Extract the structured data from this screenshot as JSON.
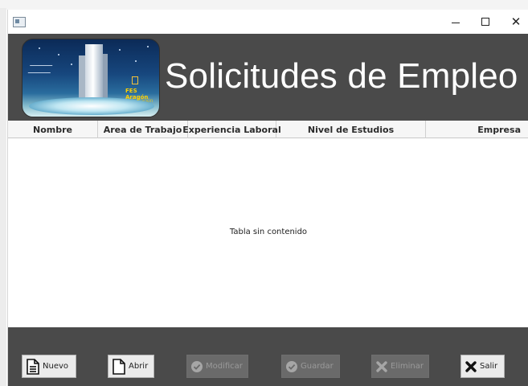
{
  "window": {
    "title": "",
    "minimize_glyph": "",
    "maximize_glyph": "",
    "close_glyph": "✕"
  },
  "header": {
    "title": "Solicitudes de Empleo",
    "logo_text_primary": "FES Aragón",
    "logo_text_secondary": "FES Aragón"
  },
  "table": {
    "columns": [
      "Nombre",
      "Area de Trabajo",
      "Experiencia Laboral",
      "Nivel de Estudios",
      "Empresa"
    ],
    "empty_message": "Tabla sin contenido"
  },
  "toolbar": {
    "buttons": [
      {
        "label": "Nuevo",
        "icon": "document-icon",
        "enabled": true
      },
      {
        "label": "Abrir",
        "icon": "file-icon",
        "enabled": true
      },
      {
        "label": "Modificar",
        "icon": "check-circle-icon",
        "enabled": false
      },
      {
        "label": "Guardar",
        "icon": "check-circle-icon",
        "enabled": false
      },
      {
        "label": "Eliminar",
        "icon": "cross-icon",
        "enabled": false
      },
      {
        "label": "Salir",
        "icon": "cross-icon",
        "enabled": true
      }
    ]
  },
  "colors": {
    "header_bg": "#4a4a4a",
    "footer_bg": "#4a4a4a",
    "title_text": "#ffffff",
    "button_bg": "#ebebeb",
    "button_disabled_bg": "#6a6a6a"
  }
}
